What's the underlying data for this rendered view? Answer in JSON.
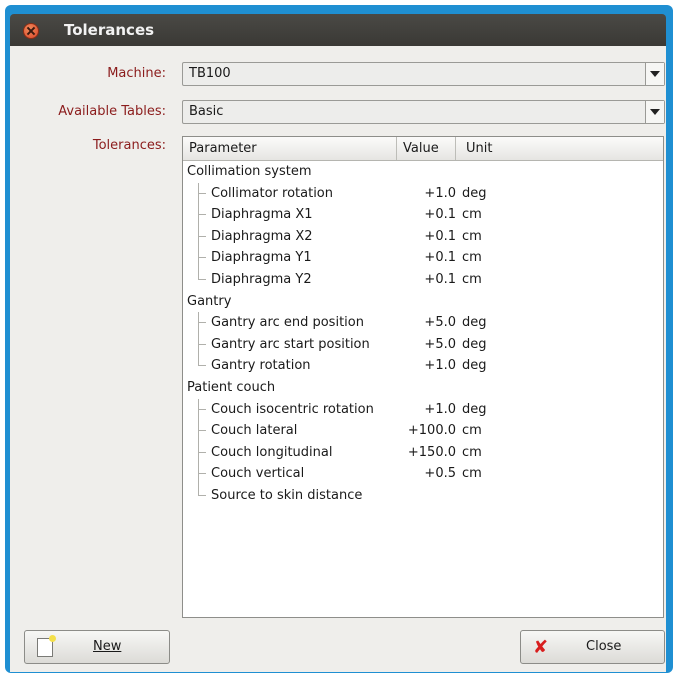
{
  "window": {
    "title": "Tolerances"
  },
  "form": {
    "machine_label": "Machine:",
    "machine_value": "TB100",
    "tables_label": "Available Tables:",
    "tables_value": "Basic",
    "tolerances_label": "Tolerances:"
  },
  "tree": {
    "columns": [
      "Parameter",
      "Value",
      "Unit"
    ],
    "groups": [
      {
        "name": "Collimation system",
        "items": [
          {
            "name": "Collimator rotation",
            "value": "+1.0",
            "unit": "deg"
          },
          {
            "name": "Diaphragma X1",
            "value": "+0.1",
            "unit": "cm"
          },
          {
            "name": "Diaphragma X2",
            "value": "+0.1",
            "unit": "cm"
          },
          {
            "name": "Diaphragma Y1",
            "value": "+0.1",
            "unit": "cm"
          },
          {
            "name": "Diaphragma Y2",
            "value": "+0.1",
            "unit": "cm"
          }
        ]
      },
      {
        "name": "Gantry",
        "items": [
          {
            "name": "Gantry arc end position",
            "value": "+5.0",
            "unit": "deg"
          },
          {
            "name": "Gantry arc start position",
            "value": "+5.0",
            "unit": "deg"
          },
          {
            "name": "Gantry rotation",
            "value": "+1.0",
            "unit": "deg"
          }
        ]
      },
      {
        "name": "Patient couch",
        "items": [
          {
            "name": "Couch isocentric rotation",
            "value": "+1.0",
            "unit": "deg"
          },
          {
            "name": "Couch lateral",
            "value": "+100.0",
            "unit": "cm"
          },
          {
            "name": "Couch longitudinal",
            "value": "+150.0",
            "unit": "cm"
          },
          {
            "name": "Couch vertical",
            "value": "+0.5",
            "unit": "cm"
          },
          {
            "name": "Source to skin distance",
            "value": "",
            "unit": ""
          }
        ]
      }
    ]
  },
  "buttons": {
    "new_label": "New",
    "close_label": "Close"
  },
  "icons": {
    "window_close": "close-icon",
    "new": "new-document-icon",
    "close": "red-x-icon"
  },
  "colors": {
    "frame": "#1f8fd2",
    "label": "#8b1c1c",
    "titlebar": "#3f3e3a"
  }
}
